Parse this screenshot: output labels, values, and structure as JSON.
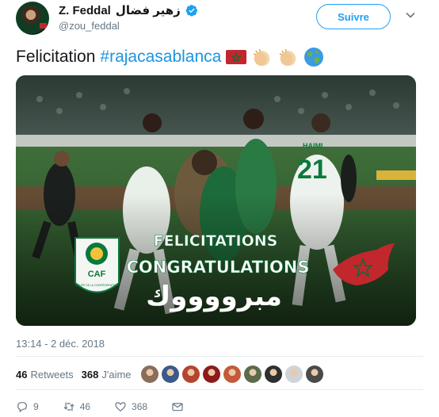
{
  "header": {
    "name": "Z. Feddal",
    "name_ar": "زهير فضال",
    "handle": "@zou_feddal",
    "follow_label": "Suivre"
  },
  "tweet": {
    "text": "Felicitation",
    "hashtag": "#rajacasablanca",
    "emojis": [
      "flag-morocco-icon",
      "clapping-hands-icon",
      "clapping-hands-icon",
      "globe-icon"
    ]
  },
  "photo": {
    "overlay_line1": "FELICITATIONS",
    "overlay_line2": "CONGRATULATIONS",
    "overlay_line3": "مبرووووك",
    "badge": "CAF",
    "badge_sub": "COUPE DE LA CONFÉDÉRATION",
    "jersey_number": "21",
    "jersey_name": "HAIMI"
  },
  "timestamp": "13:14 - 2 déc. 2018",
  "stats": {
    "retweets_count": "46",
    "retweets_label": "Retweets",
    "likes_count": "368",
    "likes_label": "J'aime"
  },
  "likers": [
    "#8a6d5a",
    "#3b5a8a",
    "#b5452e",
    "#8e1b1b",
    "#c45a3a",
    "#5a6b4a",
    "#2f2f2f",
    "#d0d4d8",
    "#4a4a4a"
  ],
  "actions": {
    "replies": "9",
    "retweets": "46",
    "likes": "368"
  },
  "colors": {
    "accent": "#1da1f2",
    "hashtag": "#1b95e0",
    "muted": "#657786",
    "raja_green": "#0a7a3c",
    "morocco_red": "#c1272d"
  }
}
